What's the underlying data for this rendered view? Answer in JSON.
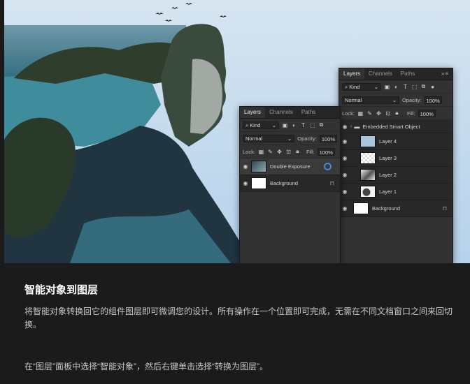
{
  "panel_back": {
    "tabs": [
      "Layers",
      "Channels",
      "Paths"
    ],
    "menu_icon": "double-chevron",
    "kind": "Kind",
    "blend_mode": "Normal",
    "opacity_label": "Opacity:",
    "opacity_value": "100%",
    "lock_label": "Lock:",
    "fill_label": "Fill:",
    "fill_value": "100%",
    "layers": [
      {
        "name": "Embedded Smart Object",
        "type": "group"
      },
      {
        "name": "Layer 4"
      },
      {
        "name": "Layer 3"
      },
      {
        "name": "Layer 2"
      },
      {
        "name": "Layer 1"
      },
      {
        "name": "Background",
        "locked": true
      }
    ]
  },
  "panel_front": {
    "tabs": [
      "Layers",
      "Channels",
      "Paths"
    ],
    "menu_icon": "double-chevron",
    "kind": "Kind",
    "blend_mode": "Normal",
    "opacity_label": "Opacity:",
    "opacity_value": "100%",
    "lock_label": "Lock:",
    "fill_label": "Fill:",
    "fill_value": "100%",
    "layers": [
      {
        "name": "Double Exposure",
        "type": "smart-object"
      },
      {
        "name": "Background",
        "locked": true
      }
    ]
  },
  "caption": {
    "title": "智能对象到图层",
    "body": "将智能对象转换回它的组件图层即可微调您的设计。所有操作在一个位置即可完成，无需在不同文档窗口之间来回切换。",
    "note": "在“图层”面板中选择“智能对象”，然后右键单击选择“转换为图层”。"
  },
  "colors": {
    "caption_bg": "#1b1b1b",
    "panel_bg": "#323232",
    "sky": "#c7dcee"
  }
}
